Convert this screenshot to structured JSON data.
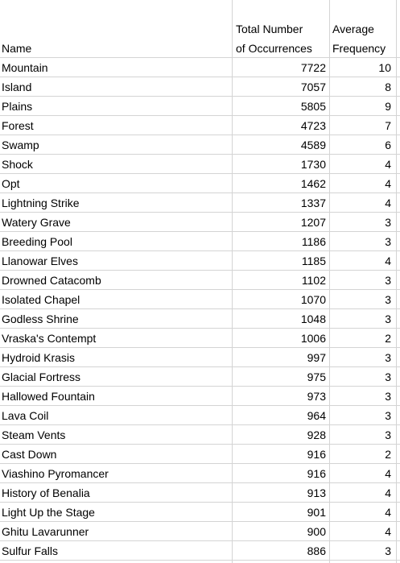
{
  "headers": {
    "name": "Name",
    "total_line1": "Total Number",
    "total_line2": "of Occurrences",
    "freq_line1": "Average",
    "freq_line2": "Frequency"
  },
  "rows": [
    {
      "name": "Mountain",
      "total": "7722",
      "freq": "10"
    },
    {
      "name": "Island",
      "total": "7057",
      "freq": "8"
    },
    {
      "name": "Plains",
      "total": "5805",
      "freq": "9"
    },
    {
      "name": "Forest",
      "total": "4723",
      "freq": "7"
    },
    {
      "name": "Swamp",
      "total": "4589",
      "freq": "6"
    },
    {
      "name": "Shock",
      "total": "1730",
      "freq": "4"
    },
    {
      "name": "Opt",
      "total": "1462",
      "freq": "4"
    },
    {
      "name": "Lightning Strike",
      "total": "1337",
      "freq": "4"
    },
    {
      "name": "Watery Grave",
      "total": "1207",
      "freq": "3"
    },
    {
      "name": "Breeding Pool",
      "total": "1186",
      "freq": "3"
    },
    {
      "name": "Llanowar Elves",
      "total": "1185",
      "freq": "4"
    },
    {
      "name": "Drowned Catacomb",
      "total": "1102",
      "freq": "3"
    },
    {
      "name": "Isolated Chapel",
      "total": "1070",
      "freq": "3"
    },
    {
      "name": "Godless Shrine",
      "total": "1048",
      "freq": "3"
    },
    {
      "name": "Vraska's Contempt",
      "total": "1006",
      "freq": "2"
    },
    {
      "name": "Hydroid Krasis",
      "total": "997",
      "freq": "3"
    },
    {
      "name": "Glacial Fortress",
      "total": "975",
      "freq": "3"
    },
    {
      "name": "Hallowed Fountain",
      "total": "973",
      "freq": "3"
    },
    {
      "name": "Lava Coil",
      "total": "964",
      "freq": "3"
    },
    {
      "name": "Steam Vents",
      "total": "928",
      "freq": "3"
    },
    {
      "name": "Cast Down",
      "total": "916",
      "freq": "2"
    },
    {
      "name": "Viashino Pyromancer",
      "total": "916",
      "freq": "4"
    },
    {
      "name": "History of Benalia",
      "total": "913",
      "freq": "4"
    },
    {
      "name": "Light Up the Stage",
      "total": "901",
      "freq": "4"
    },
    {
      "name": "Ghitu Lavarunner",
      "total": "900",
      "freq": "4"
    },
    {
      "name": "Sulfur Falls",
      "total": "886",
      "freq": "3"
    }
  ]
}
